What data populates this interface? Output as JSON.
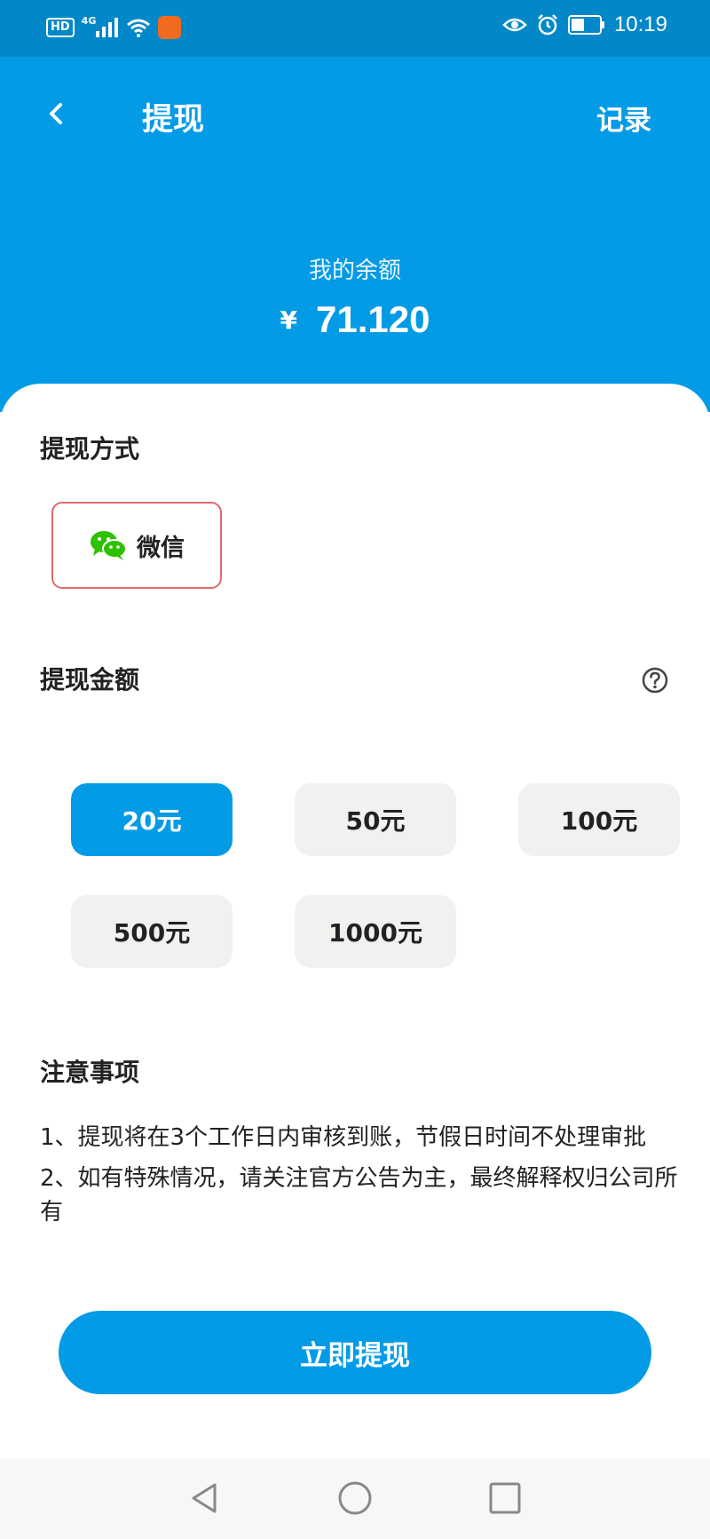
{
  "status_bar": {
    "hd": "HD",
    "network": "4G",
    "time": "10:19",
    "icons": [
      "signal-icon",
      "wifi-icon",
      "app-notification-icon",
      "eye-icon",
      "alarm-icon",
      "battery-icon"
    ]
  },
  "header": {
    "title": "提现",
    "records": "记录",
    "balance_label": "我的余额",
    "currency": "¥",
    "balance": "71.120"
  },
  "withdraw_method": {
    "title": "提现方式",
    "option_label": "微信"
  },
  "withdraw_amount": {
    "title": "提现金额",
    "options": [
      "20元",
      "50元",
      "100元",
      "500元",
      "1000元"
    ],
    "selected_index": 0
  },
  "notice": {
    "title": "注意事项",
    "line1": "1、提现将在3个工作日内审核到账，节假日时间不处理审批",
    "line2": "2、如有特殊情况，请关注官方公告为主，最终解释权归公司所有"
  },
  "submit_label": "立即提现",
  "colors": {
    "primary": "#039be5",
    "status_bar": "#0288c8",
    "selected_border": "#e06a6a",
    "unselected_bg": "#f2f1ef",
    "wechat_green": "#2dc100"
  }
}
